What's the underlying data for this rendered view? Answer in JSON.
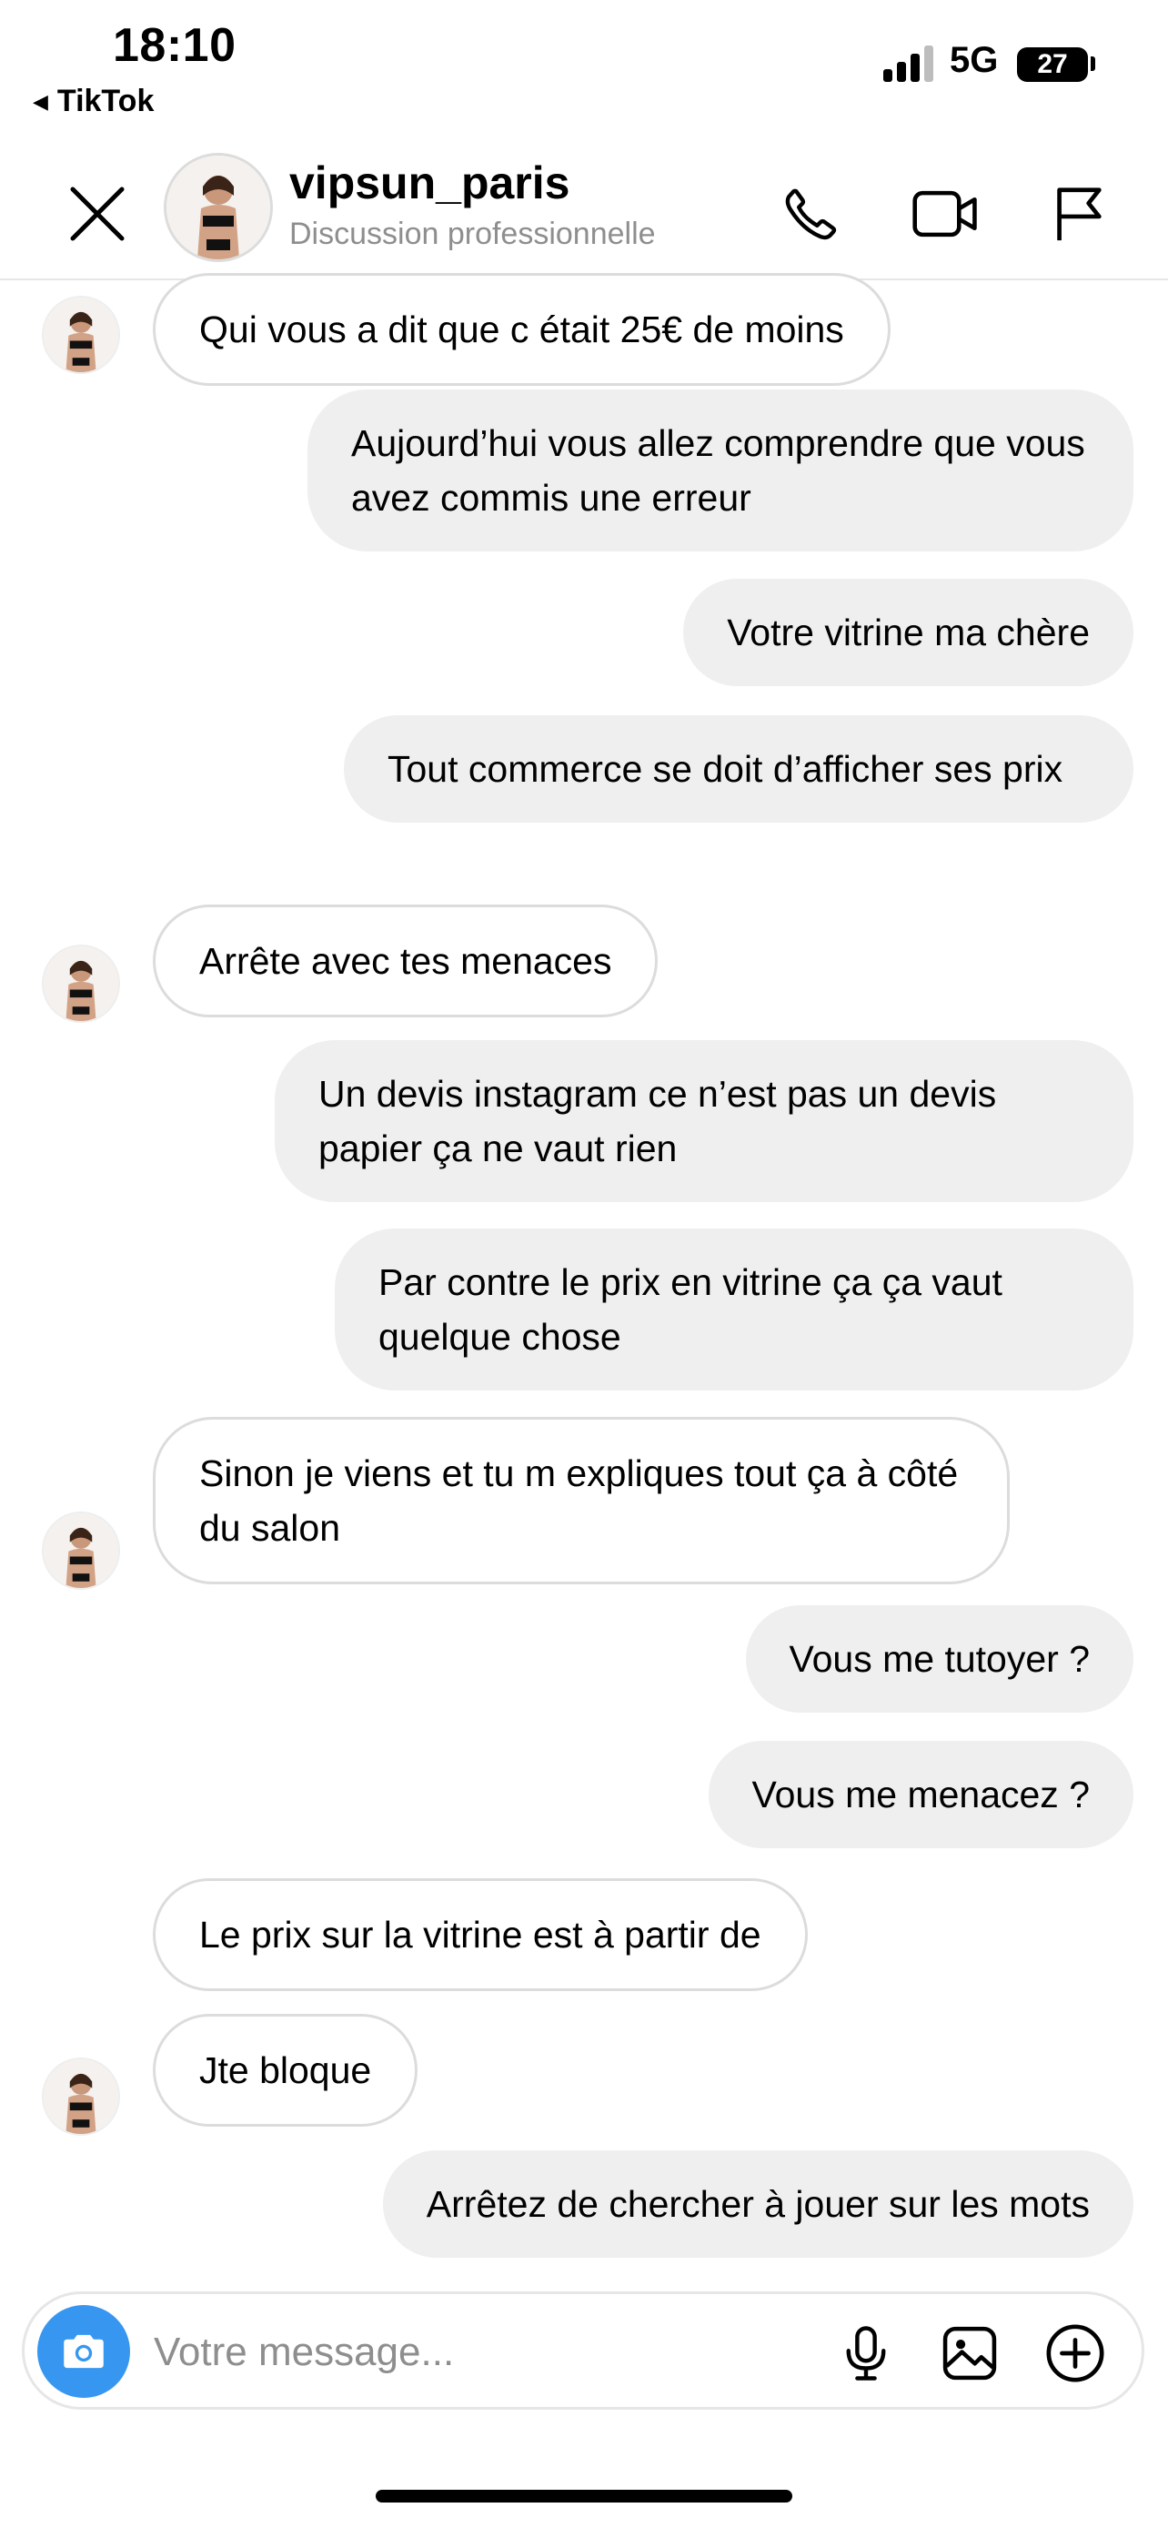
{
  "status_bar": {
    "time": "18:10",
    "back_app": "TikTok",
    "network": "5G",
    "battery": "27"
  },
  "header": {
    "username": "vipsun_paris",
    "subtitle": "Discussion professionnelle",
    "icons": [
      "close-icon",
      "phone-icon",
      "video-camera-icon",
      "flag-icon"
    ]
  },
  "messages": [
    {
      "side": "in",
      "text": "Qui vous a dit que c était 25€ de moins"
    },
    {
      "side": "out",
      "text": "Aujourd’hui vous allez comprendre que vous avez commis une erreur"
    },
    {
      "side": "out",
      "text": "Votre vitrine ma chère"
    },
    {
      "side": "out",
      "text": "Tout commerce se doit d’afficher ses prix"
    },
    {
      "side": "in",
      "text": "Arrête avec tes menaces"
    },
    {
      "side": "out",
      "text": "Un devis instagram ce n’est pas un devis papier ça ne vaut rien"
    },
    {
      "side": "out",
      "text": "Par contre le prix en vitrine ça ça vaut quelque chose"
    },
    {
      "side": "in",
      "text": "Sinon je viens et tu m expliques tout ça à côté du salon"
    },
    {
      "side": "out",
      "text": "Vous me tutoyer ?"
    },
    {
      "side": "out",
      "text": "Vous me menacez ?"
    },
    {
      "side": "in",
      "text": "Le prix sur la vitrine est à partir de"
    },
    {
      "side": "in",
      "text": "Jte bloque"
    },
    {
      "side": "out",
      "text": "Arrêtez de chercher à jouer sur les mots"
    }
  ],
  "composer": {
    "placeholder": "Votre message...",
    "icons": [
      "camera-icon",
      "microphone-icon",
      "image-icon",
      "plus-icon"
    ]
  },
  "colors": {
    "accent": "#3797f0",
    "outgoing_bubble": "#efefef",
    "incoming_border": "#dcdcdc",
    "secondary_text": "#8e8e8e"
  }
}
